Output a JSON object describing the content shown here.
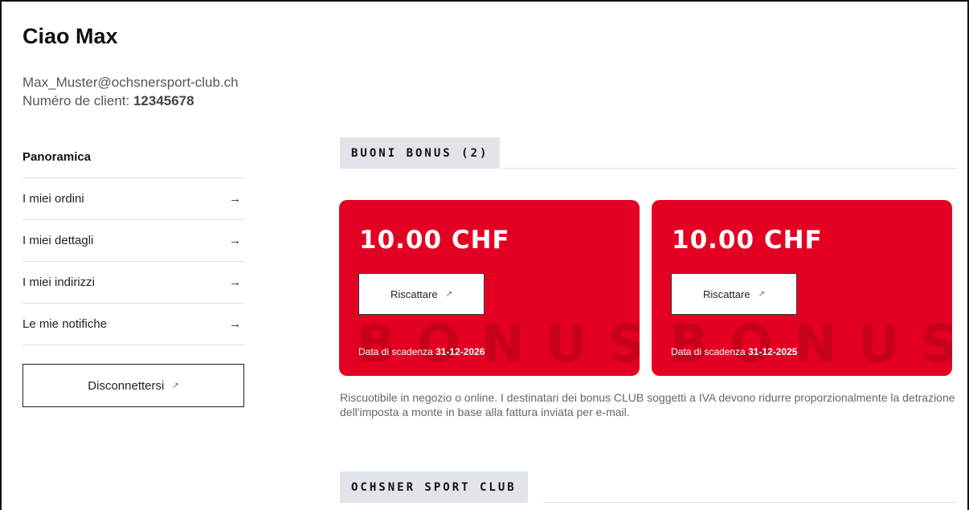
{
  "header": {
    "greeting": "Ciao Max",
    "email": "Max_Muster@ochsnersport-club.ch",
    "client_label": "Numéro de client:",
    "client_number": "12345678"
  },
  "sidebar": {
    "heading": "Panoramica",
    "items": [
      {
        "label": "I miei ordini",
        "icon": "arrow-right-icon"
      },
      {
        "label": "I miei dettagli",
        "icon": "arrow-right-icon"
      },
      {
        "label": "I miei indirizzi",
        "icon": "arrow-right-icon"
      },
      {
        "label": "Le mie notifiche",
        "icon": "arrow-right-icon"
      }
    ],
    "logout_label": "Disconnettersi"
  },
  "bonus": {
    "title": "BUONI BONUS (2)",
    "vouchers": [
      {
        "amount": "10.00 CHF",
        "button": "Riscattare",
        "watermark": "BONUS",
        "expiry_label": "Data di scadenza",
        "expiry_date": "31-12-2026"
      },
      {
        "amount": "10.00 CHF",
        "button": "Riscattare",
        "watermark": "BONUS",
        "expiry_label": "Data di scadenza",
        "expiry_date": "31-12-2025"
      }
    ],
    "note": "Riscuotibile in negozio o online. I destinatari dei bonus CLUB soggetti a IVA devono ridurre proporzionalmente la detrazione dell'imposta a monte in base alla fattura inviata per e-mail."
  },
  "club": {
    "title": "OCHSNER SPORT CLUB"
  },
  "colors": {
    "card_red": "#e30022",
    "tab_bg": "#e1e5e9"
  }
}
